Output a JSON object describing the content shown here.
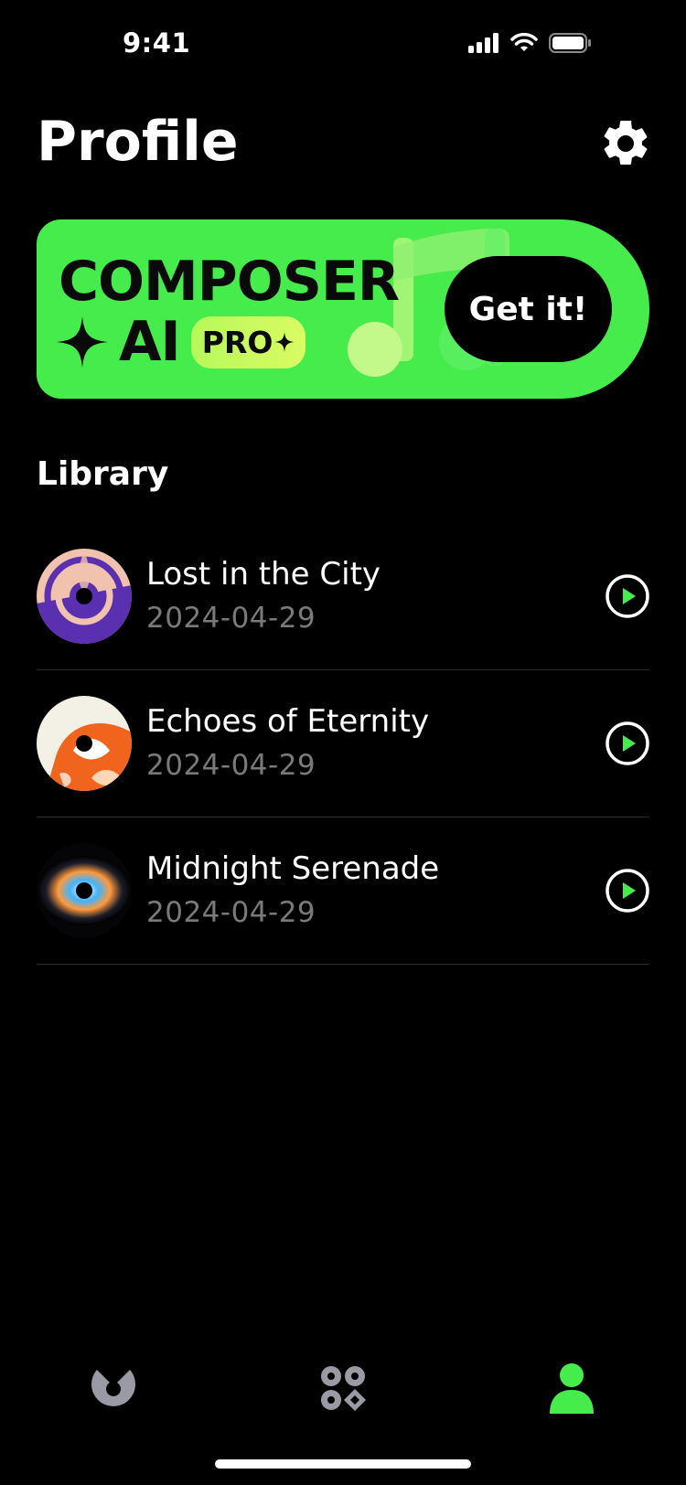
{
  "status_bar": {
    "time": "9:41"
  },
  "header": {
    "title": "Profile"
  },
  "promo": {
    "title_line1": "COMPOSER",
    "title_ai": "AI",
    "badge": "PRO",
    "cta": "Get it!",
    "colors": {
      "background": "#45ec4c",
      "badge": "#c6fa5f"
    }
  },
  "library": {
    "title": "Library",
    "items": [
      {
        "title": "Lost in the City",
        "date": "2024-04-29",
        "cover": "purple-peach-geometric"
      },
      {
        "title": "Echoes of Eternity",
        "date": "2024-04-29",
        "cover": "orange-white-abstract"
      },
      {
        "title": "Midnight Serenade",
        "date": "2024-04-29",
        "cover": "spectral-glow"
      }
    ]
  },
  "tabbar": {
    "tabs": [
      {
        "icon": "disc-icon",
        "active": false
      },
      {
        "icon": "grid-icon",
        "active": false
      },
      {
        "icon": "person-icon",
        "active": true
      }
    ],
    "colors": {
      "active": "#45ec4c",
      "inactive": "#9a9aa4"
    }
  }
}
